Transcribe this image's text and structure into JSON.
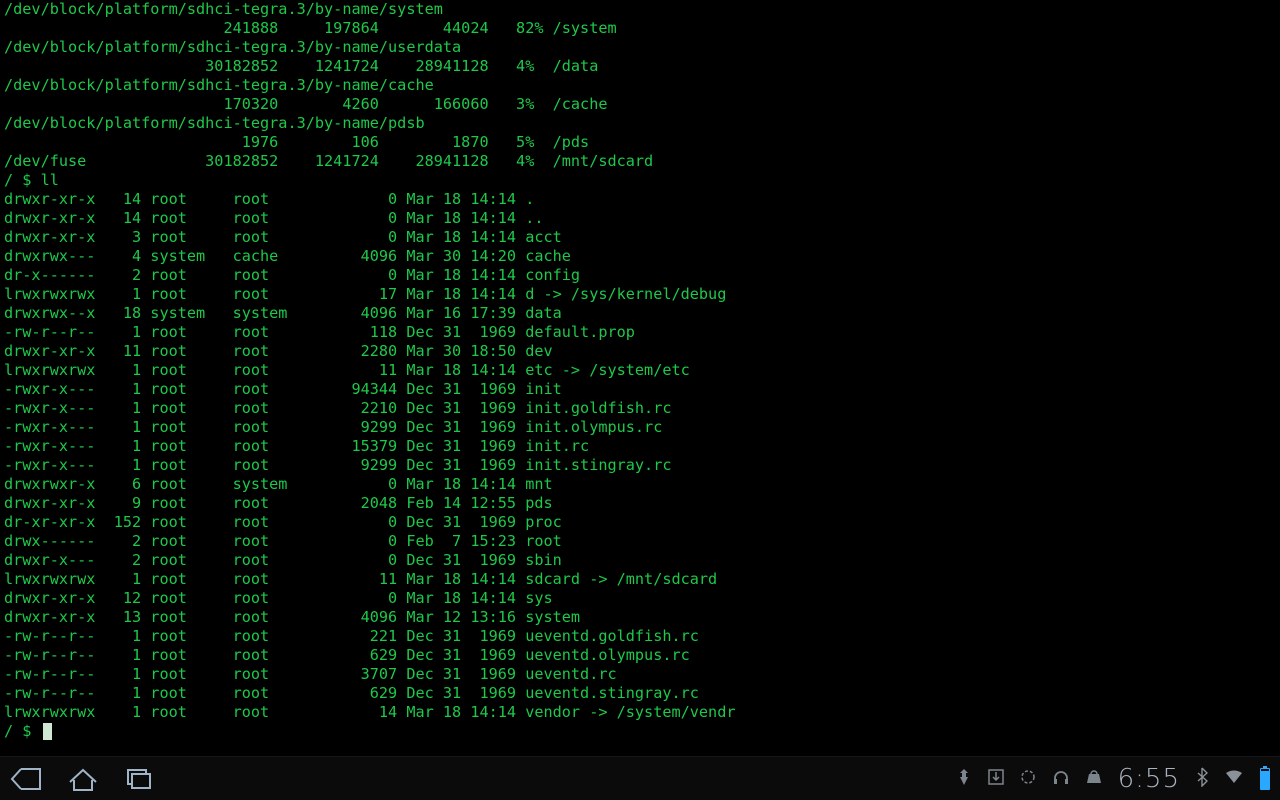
{
  "df": [
    {
      "dev": "/dev/block/platform/sdhci-tegra.3/by-name/system",
      "blocks": "241888",
      "used": "197864",
      "avail": "44024",
      "pct": "82%",
      "mount": "/system"
    },
    {
      "dev": "/dev/block/platform/sdhci-tegra.3/by-name/userdata",
      "blocks": "30182852",
      "used": "1241724",
      "avail": "28941128",
      "pct": "4%",
      "mount": "/data"
    },
    {
      "dev": "/dev/block/platform/sdhci-tegra.3/by-name/cache",
      "blocks": "170320",
      "used": "4260",
      "avail": "166060",
      "pct": "3%",
      "mount": "/cache"
    },
    {
      "dev": "/dev/block/platform/sdhci-tegra.3/by-name/pdsb",
      "blocks": "1976",
      "used": "106",
      "avail": "1870",
      "pct": "5%",
      "mount": "/pds"
    },
    {
      "dev": "/dev/fuse",
      "blocks": "30182852",
      "used": "1241724",
      "avail": "28941128",
      "pct": "4%",
      "mount": "/mnt/sdcard",
      "single": true
    }
  ],
  "prompt1": "/ $ ll",
  "ls": [
    {
      "perm": "drwxr-xr-x",
      "n": "14",
      "own": "root",
      "grp": "root",
      "size": "0",
      "date": "Mar 18 14:14",
      "name": "."
    },
    {
      "perm": "drwxr-xr-x",
      "n": "14",
      "own": "root",
      "grp": "root",
      "size": "0",
      "date": "Mar 18 14:14",
      "name": ".."
    },
    {
      "perm": "drwxr-xr-x",
      "n": "3",
      "own": "root",
      "grp": "root",
      "size": "0",
      "date": "Mar 18 14:14",
      "name": "acct"
    },
    {
      "perm": "drwxrwx---",
      "n": "4",
      "own": "system",
      "grp": "cache",
      "size": "4096",
      "date": "Mar 30 14:20",
      "name": "cache"
    },
    {
      "perm": "dr-x------",
      "n": "2",
      "own": "root",
      "grp": "root",
      "size": "0",
      "date": "Mar 18 14:14",
      "name": "config"
    },
    {
      "perm": "lrwxrwxrwx",
      "n": "1",
      "own": "root",
      "grp": "root",
      "size": "17",
      "date": "Mar 18 14:14",
      "name": "d -> /sys/kernel/debug"
    },
    {
      "perm": "drwxrwx--x",
      "n": "18",
      "own": "system",
      "grp": "system",
      "size": "4096",
      "date": "Mar 16 17:39",
      "name": "data"
    },
    {
      "perm": "-rw-r--r--",
      "n": "1",
      "own": "root",
      "grp": "root",
      "size": "118",
      "date": "Dec 31  1969",
      "name": "default.prop"
    },
    {
      "perm": "drwxr-xr-x",
      "n": "11",
      "own": "root",
      "grp": "root",
      "size": "2280",
      "date": "Mar 30 18:50",
      "name": "dev"
    },
    {
      "perm": "lrwxrwxrwx",
      "n": "1",
      "own": "root",
      "grp": "root",
      "size": "11",
      "date": "Mar 18 14:14",
      "name": "etc -> /system/etc"
    },
    {
      "perm": "-rwxr-x---",
      "n": "1",
      "own": "root",
      "grp": "root",
      "size": "94344",
      "date": "Dec 31  1969",
      "name": "init"
    },
    {
      "perm": "-rwxr-x---",
      "n": "1",
      "own": "root",
      "grp": "root",
      "size": "2210",
      "date": "Dec 31  1969",
      "name": "init.goldfish.rc"
    },
    {
      "perm": "-rwxr-x---",
      "n": "1",
      "own": "root",
      "grp": "root",
      "size": "9299",
      "date": "Dec 31  1969",
      "name": "init.olympus.rc"
    },
    {
      "perm": "-rwxr-x---",
      "n": "1",
      "own": "root",
      "grp": "root",
      "size": "15379",
      "date": "Dec 31  1969",
      "name": "init.rc"
    },
    {
      "perm": "-rwxr-x---",
      "n": "1",
      "own": "root",
      "grp": "root",
      "size": "9299",
      "date": "Dec 31  1969",
      "name": "init.stingray.rc"
    },
    {
      "perm": "drwxrwxr-x",
      "n": "6",
      "own": "root",
      "grp": "system",
      "size": "0",
      "date": "Mar 18 14:14",
      "name": "mnt"
    },
    {
      "perm": "drwxr-xr-x",
      "n": "9",
      "own": "root",
      "grp": "root",
      "size": "2048",
      "date": "Feb 14 12:55",
      "name": "pds"
    },
    {
      "perm": "dr-xr-xr-x",
      "n": "152",
      "own": "root",
      "grp": "root",
      "size": "0",
      "date": "Dec 31  1969",
      "name": "proc"
    },
    {
      "perm": "drwx------",
      "n": "2",
      "own": "root",
      "grp": "root",
      "size": "0",
      "date": "Feb  7 15:23",
      "name": "root"
    },
    {
      "perm": "drwxr-x---",
      "n": "2",
      "own": "root",
      "grp": "root",
      "size": "0",
      "date": "Dec 31  1969",
      "name": "sbin"
    },
    {
      "perm": "lrwxrwxrwx",
      "n": "1",
      "own": "root",
      "grp": "root",
      "size": "11",
      "date": "Mar 18 14:14",
      "name": "sdcard -> /mnt/sdcard"
    },
    {
      "perm": "drwxr-xr-x",
      "n": "12",
      "own": "root",
      "grp": "root",
      "size": "0",
      "date": "Mar 18 14:14",
      "name": "sys"
    },
    {
      "perm": "drwxr-xr-x",
      "n": "13",
      "own": "root",
      "grp": "root",
      "size": "4096",
      "date": "Mar 12 13:16",
      "name": "system"
    },
    {
      "perm": "-rw-r--r--",
      "n": "1",
      "own": "root",
      "grp": "root",
      "size": "221",
      "date": "Dec 31  1969",
      "name": "ueventd.goldfish.rc"
    },
    {
      "perm": "-rw-r--r--",
      "n": "1",
      "own": "root",
      "grp": "root",
      "size": "629",
      "date": "Dec 31  1969",
      "name": "ueventd.olympus.rc"
    },
    {
      "perm": "-rw-r--r--",
      "n": "1",
      "own": "root",
      "grp": "root",
      "size": "3707",
      "date": "Dec 31  1969",
      "name": "ueventd.rc"
    },
    {
      "perm": "-rw-r--r--",
      "n": "1",
      "own": "root",
      "grp": "root",
      "size": "629",
      "date": "Dec 31  1969",
      "name": "ueventd.stingray.rc"
    },
    {
      "perm": "lrwxrwxrwx",
      "n": "1",
      "own": "root",
      "grp": "root",
      "size": "14",
      "date": "Mar 18 14:14",
      "name": "vendor -> /system/vendr"
    }
  ],
  "prompt2": "/ $ ",
  "status": {
    "time": "6:55"
  }
}
